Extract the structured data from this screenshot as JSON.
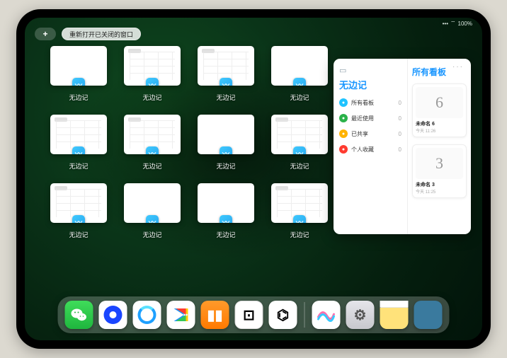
{
  "status": {
    "battery": "100%",
    "signal": "•••",
    "wifi": "⌔"
  },
  "top_controls": {
    "plus_label": "+",
    "reopen_label": "重新打开已关闭的窗口"
  },
  "window_cards": [
    {
      "label": "无边记",
      "type": "blank"
    },
    {
      "label": "无边记",
      "type": "grid"
    },
    {
      "label": "无边记",
      "type": "grid"
    },
    {
      "label": "无边记",
      "type": "blank"
    },
    {
      "label": "无边记",
      "type": "grid"
    },
    {
      "label": "无边记",
      "type": "grid"
    },
    {
      "label": "无边记",
      "type": "blank"
    },
    {
      "label": "无边记",
      "type": "grid"
    },
    {
      "label": "无边记",
      "type": "grid"
    },
    {
      "label": "无边记",
      "type": "blank"
    },
    {
      "label": "无边记",
      "type": "blank"
    },
    {
      "label": "无边记",
      "type": "grid"
    }
  ],
  "panel": {
    "left_title": "无边记",
    "right_title": "所有看板",
    "menu_hint": "···",
    "filters": [
      {
        "name": "所有看板",
        "count": "0",
        "color": "#1fc3ff"
      },
      {
        "name": "最近使用",
        "count": "0",
        "color": "#2bb24a"
      },
      {
        "name": "已共享",
        "count": "0",
        "color": "#ffb300"
      },
      {
        "name": "个人收藏",
        "count": "0",
        "color": "#ff3b30"
      }
    ],
    "boards": [
      {
        "name": "未命名 6",
        "sub": "今天 11:26",
        "glyph": "6"
      },
      {
        "name": "未命名 3",
        "sub": "今天 11:25",
        "glyph": "3"
      }
    ]
  },
  "dock": {
    "apps_main": [
      {
        "id": "wechat",
        "glyph": "✦",
        "label": "WeChat"
      },
      {
        "id": "white",
        "glyph": "◑",
        "label": "HD"
      },
      {
        "id": "browser",
        "glyph": "◯",
        "label": "Browser"
      },
      {
        "id": "play",
        "glyph": "▶",
        "label": "Video"
      },
      {
        "id": "books",
        "glyph": "▮▮",
        "label": "Books"
      },
      {
        "id": "ludo",
        "glyph": "⊡",
        "label": "Game"
      },
      {
        "id": "graph",
        "glyph": "⌬",
        "label": "Nodes"
      }
    ],
    "apps_recent": [
      {
        "id": "freeform",
        "glyph": "〰",
        "label": "无边记"
      },
      {
        "id": "settings",
        "glyph": "⚙",
        "label": "Settings"
      },
      {
        "id": "notes",
        "glyph": "≡",
        "label": "Notes"
      },
      {
        "id": "folder",
        "glyph": "",
        "label": "Folder"
      }
    ]
  }
}
